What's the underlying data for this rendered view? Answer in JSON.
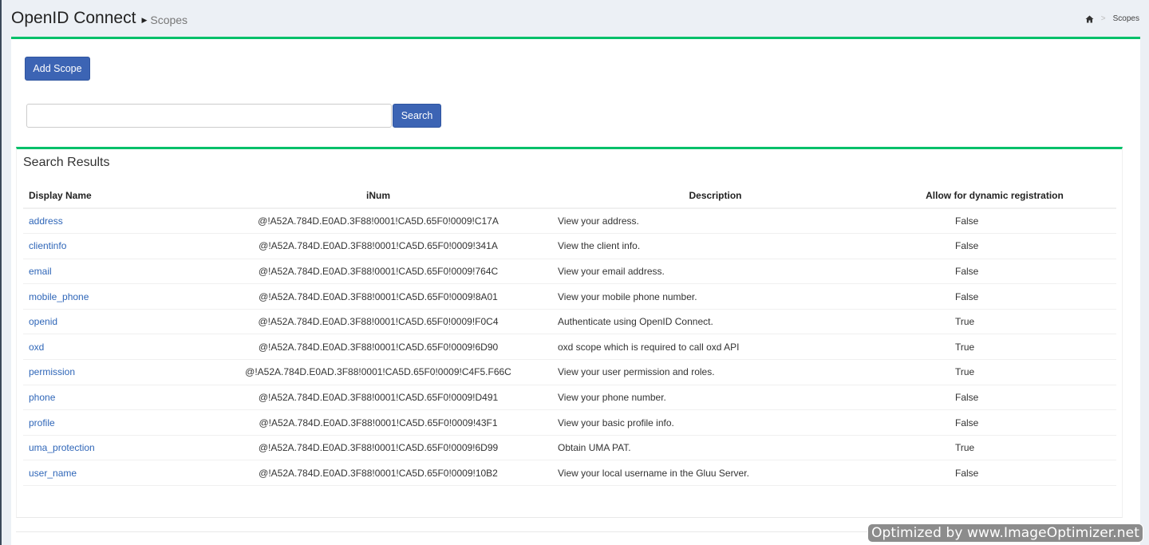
{
  "header": {
    "title": "OpenID Connect",
    "subtitle": "Scopes",
    "breadcrumb": {
      "icon": "home-icon",
      "current": "Scopes"
    }
  },
  "toolbar": {
    "add_label": "Add Scope",
    "search_value": "",
    "search_label": "Search"
  },
  "results": {
    "title": "Search Results",
    "columns": [
      "Display Name",
      "iNum",
      "Description",
      "Allow for dynamic registration"
    ],
    "rows": [
      {
        "name": "address",
        "inum": "@!A52A.784D.E0AD.3F88!0001!CA5D.65F0!0009!C17A",
        "description": "View your address.",
        "dynamic": "False"
      },
      {
        "name": "clientinfo",
        "inum": "@!A52A.784D.E0AD.3F88!0001!CA5D.65F0!0009!341A",
        "description": "View the client info.",
        "dynamic": "False"
      },
      {
        "name": "email",
        "inum": "@!A52A.784D.E0AD.3F88!0001!CA5D.65F0!0009!764C",
        "description": "View your email address.",
        "dynamic": "False"
      },
      {
        "name": "mobile_phone",
        "inum": "@!A52A.784D.E0AD.3F88!0001!CA5D.65F0!0009!8A01",
        "description": "View your mobile phone number.",
        "dynamic": "False"
      },
      {
        "name": "openid",
        "inum": "@!A52A.784D.E0AD.3F88!0001!CA5D.65F0!0009!F0C4",
        "description": "Authenticate using OpenID Connect.",
        "dynamic": "True"
      },
      {
        "name": "oxd",
        "inum": "@!A52A.784D.E0AD.3F88!0001!CA5D.65F0!0009!6D90",
        "description": "oxd scope which is required to call oxd API",
        "dynamic": "True"
      },
      {
        "name": "permission",
        "inum": "@!A52A.784D.E0AD.3F88!0001!CA5D.65F0!0009!C4F5.F66C",
        "description": "View your user permission and roles.",
        "dynamic": "True"
      },
      {
        "name": "phone",
        "inum": "@!A52A.784D.E0AD.3F88!0001!CA5D.65F0!0009!D491",
        "description": "View your phone number.",
        "dynamic": "False"
      },
      {
        "name": "profile",
        "inum": "@!A52A.784D.E0AD.3F88!0001!CA5D.65F0!0009!43F1",
        "description": "View your basic profile info.",
        "dynamic": "False"
      },
      {
        "name": "uma_protection",
        "inum": "@!A52A.784D.E0AD.3F88!0001!CA5D.65F0!0009!6D99",
        "description": "Obtain UMA PAT.",
        "dynamic": "True"
      },
      {
        "name": "user_name",
        "inum": "@!A52A.784D.E0AD.3F88!0001!CA5D.65F0!0009!10B2",
        "description": "View your local username in the Gluu Server.",
        "dynamic": "False"
      }
    ]
  },
  "watermark": "Optimized by www.ImageOptimizer.net"
}
